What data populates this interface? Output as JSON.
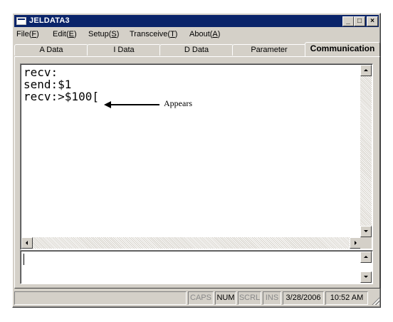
{
  "window": {
    "title": "JELDATA3",
    "min": "_",
    "max": "□",
    "close": "×"
  },
  "menu": [
    {
      "label": "File(",
      "key": "F",
      "suffix": ")"
    },
    {
      "label": "Edit(",
      "key": "E",
      "suffix": ")"
    },
    {
      "label": "Setup(",
      "key": "S",
      "suffix": ")"
    },
    {
      "label": "Transceive(",
      "key": "T",
      "suffix": ")"
    },
    {
      "label": "About(",
      "key": "A",
      "suffix": ")"
    }
  ],
  "tabs": [
    "A Data",
    "I Data",
    "D Data",
    "Parameter",
    "Communication"
  ],
  "active_tab": "Communication",
  "log_text": "recv:\nsend:$1\nrecv:>$100[",
  "send_text": "",
  "annotation": "Appears",
  "status": {
    "caps": "CAPS",
    "num": "NUM",
    "scrl": "SCRL",
    "ins": "INS",
    "date": "3/28/2006",
    "time": "10:52 AM"
  }
}
